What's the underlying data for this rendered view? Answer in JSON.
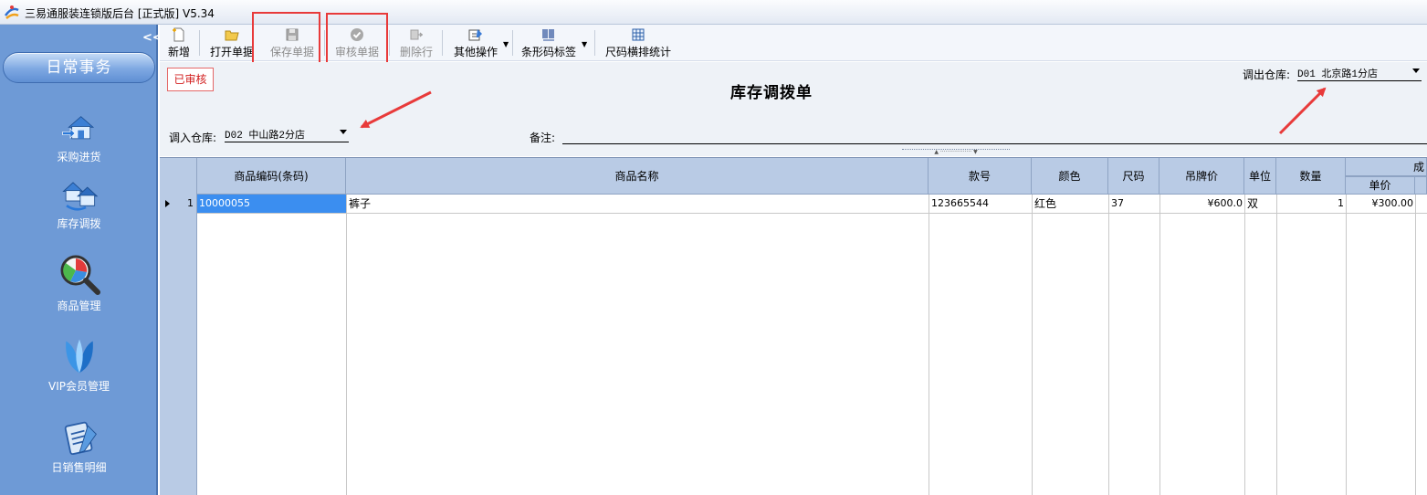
{
  "window": {
    "title": "三易通服装连锁版后台 [正式版] V5.34"
  },
  "sidebar": {
    "collapse_label": "<<",
    "header": "日常事务",
    "items": [
      {
        "label": "采购进货",
        "icon": "purchase-house-icon"
      },
      {
        "label": "库存调拨",
        "icon": "transfer-houses-icon"
      },
      {
        "label": "商品管理",
        "icon": "magnifier-chart-icon"
      },
      {
        "label": "VIP会员管理",
        "icon": "butterfly-leaf-icon"
      },
      {
        "label": "日销售明细",
        "icon": "clipboard-pen-icon"
      }
    ]
  },
  "toolbar": {
    "new_label": "新增",
    "open_label": "打开单据",
    "save_label": "保存单据",
    "audit_label": "审核单据",
    "delete_row_label": "删除行",
    "other_ops_label": "其他操作",
    "barcode_label": "条形码标签",
    "size_stats_label": "尺码横排统计"
  },
  "form": {
    "status": "已审核",
    "title": "库存调拨单",
    "out_warehouse_label": "调出仓库:",
    "out_warehouse_value": "D01 北京路1分店",
    "in_warehouse_label": "调入仓库:",
    "in_warehouse_value": "D02 中山路2分店",
    "remark_label": "备注:",
    "remark_value": ""
  },
  "grid": {
    "headers": {
      "code": "商品编码(条码)",
      "name": "商品名称",
      "style": "款号",
      "color": "颜色",
      "size": "尺码",
      "tag_price": "吊牌价",
      "unit": "单位",
      "qty": "数量",
      "cost_group": "成",
      "unit_price": "单价"
    },
    "rows": [
      {
        "index": "1",
        "code": "10000055",
        "name": "裤子",
        "style": "123665544",
        "color": "红色",
        "size": "37",
        "tag_price": "¥600.0",
        "unit": "双",
        "qty": "1",
        "unit_price": "¥300.00"
      }
    ]
  },
  "colors": {
    "sidebar_bg": "#6e9ad6",
    "annotation_red": "#e83a3a",
    "selected_cell": "#3b8ef0",
    "grid_header": "#b9cbe5"
  }
}
